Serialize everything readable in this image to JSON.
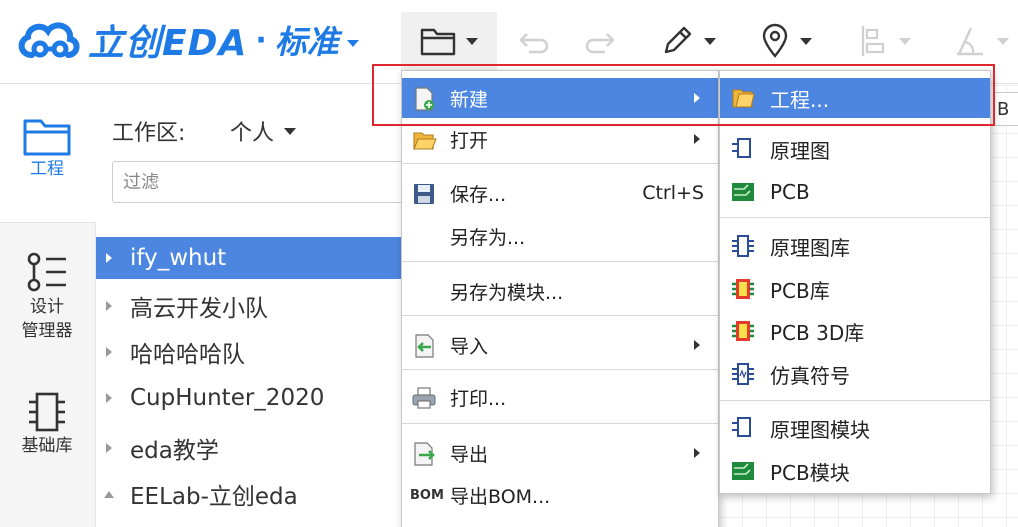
{
  "app": {
    "logo_name": "立创EDA",
    "logo_dot": "·",
    "edition": "标准"
  },
  "toolbar": {
    "icons": [
      "folder-icon",
      "undo-icon",
      "redo-icon",
      "pencil-icon",
      "location-pin-icon",
      "align-icon",
      "measure-icon"
    ]
  },
  "rail": {
    "project": "工程",
    "design_manager": "设计\n管理器",
    "library": "基础库"
  },
  "workspace": {
    "label": "工作区:",
    "value": "个人",
    "filter_placeholder": "过滤"
  },
  "tree": [
    {
      "label": "ify_whut",
      "selected": true
    },
    {
      "label": "高云开发小队"
    },
    {
      "label": "哈哈哈哈队"
    },
    {
      "label": "CupHunter_2020"
    },
    {
      "label": "eda教学"
    },
    {
      "label": "EELab-立创eda",
      "expanded": true
    }
  ],
  "file_menu": {
    "new": "新建",
    "open": "打开",
    "save": "保存...",
    "save_shortcut": "Ctrl+S",
    "save_as": "另存为...",
    "save_as_module": "另存为模块...",
    "import": "导入",
    "print": "打印...",
    "export": "导出",
    "bom_icon_text": "BOM",
    "export_bom": "导出BOM..."
  },
  "new_submenu": {
    "project": "工程...",
    "schematic": "原理图",
    "pcb": "PCB",
    "schematic_lib": "原理图库",
    "pcb_lib": "PCB库",
    "pcb_3d_lib": "PCB 3D库",
    "sim_symbol": "仿真符号",
    "schematic_module": "原理图模块",
    "pcb_module": "PCB模块"
  },
  "canvas_tab_fragment": "B",
  "colors": {
    "brand_blue": "#1e7be6",
    "menu_highlight": "#4d86e0",
    "annotation_red": "#e0262f"
  }
}
